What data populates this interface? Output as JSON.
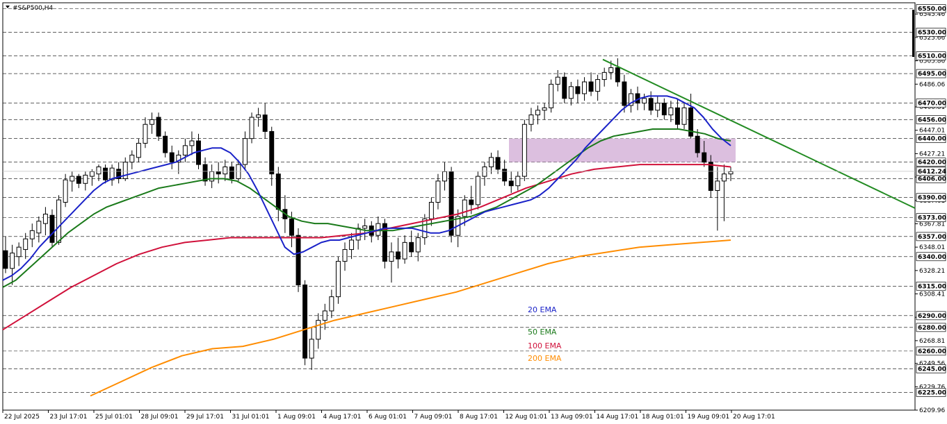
{
  "chart_title": "#S&P500,H4",
  "colors": {
    "background": "#ffffff",
    "candle_up_fill": "#ffffff",
    "candle_down_fill": "#000000",
    "ema20": "#1a22c8",
    "ema50": "#1a7a1a",
    "ema100": "#d0103a",
    "ema200": "#ff8c00",
    "trendline": "#228b22",
    "zone": "#d8b8dc",
    "level_line": "#000000"
  },
  "chart_data": {
    "type": "candlestick",
    "title": "#S&P500,H4",
    "ylim": [
      6209.96,
      6555
    ],
    "price_axis_ticks": [
      "6545.46",
      "6525.66",
      "6505.86",
      "6486.06",
      "6466.81",
      "6447.01",
      "6427.21",
      "6407.41",
      "6387.61",
      "6367.81",
      "6348.01",
      "6328.21",
      "6308.41",
      "6288.61",
      "6268.81",
      "6249.56",
      "6229.76",
      "6209.96"
    ],
    "level_labels": [
      "6550.00",
      "6530.00",
      "6510.00",
      "6495.00",
      "6470.00",
      "6456.00",
      "6440.00",
      "6420.00",
      "6406.00",
      "6390.00",
      "6373.00",
      "6357.00",
      "6340.00",
      "6315.00",
      "6290.00",
      "6280.00",
      "6260.00",
      "6245.00",
      "6225.00"
    ],
    "current_price": "6412.24",
    "time_labels": [
      "22 Jul 2025",
      "23 Jul 17:01",
      "25 Jul 01:01",
      "28 Jul 09:01",
      "29 Jul 17:01",
      "31 Jul 01:01",
      "1 Aug 09:01",
      "4 Aug 17:01",
      "6 Aug 01:01",
      "7 Aug 09:01",
      "8 Aug 17:01",
      "12 Aug 01:01",
      "13 Aug 09:01",
      "14 Aug 17:01",
      "18 Aug 01:01",
      "19 Aug 09:01",
      "20 Aug 17:01"
    ],
    "legend": [
      {
        "label": "20 EMA",
        "color": "#1a22c8"
      },
      {
        "label": "50 EMA",
        "color": "#1a7a1a"
      },
      {
        "label": "100 EMA",
        "color": "#d0103a"
      },
      {
        "label": "200 EMA",
        "color": "#ff8c00"
      }
    ],
    "resistance_zone": {
      "low": 6420,
      "high": 6440
    },
    "trendline": {
      "from": {
        "x": "14 Aug 17:01",
        "y": 6507
      },
      "to": {
        "x": "21 Aug",
        "y": 6381
      }
    },
    "candles": [
      [
        6345,
        6357,
        6326,
        6330
      ],
      [
        6330,
        6350,
        6316,
        6343
      ],
      [
        6340,
        6352,
        6332,
        6348
      ],
      [
        6346,
        6360,
        6338,
        6355
      ],
      [
        6355,
        6368,
        6348,
        6362
      ],
      [
        6360,
        6374,
        6352,
        6370
      ],
      [
        6368,
        6382,
        6358,
        6376
      ],
      [
        6375,
        6380,
        6348,
        6352
      ],
      [
        6352,
        6392,
        6350,
        6388
      ],
      [
        6386,
        6410,
        6382,
        6405
      ],
      [
        6404,
        6412,
        6395,
        6408
      ],
      [
        6408,
        6410,
        6398,
        6402
      ],
      [
        6402,
        6412,
        6396,
        6409
      ],
      [
        6408,
        6414,
        6400,
        6412
      ],
      [
        6410,
        6418,
        6404,
        6416
      ],
      [
        6415,
        6418,
        6402,
        6405
      ],
      [
        6405,
        6418,
        6400,
        6415
      ],
      [
        6414,
        6420,
        6402,
        6406
      ],
      [
        6406,
        6424,
        6404,
        6420
      ],
      [
        6420,
        6430,
        6414,
        6426
      ],
      [
        6424,
        6440,
        6420,
        6436
      ],
      [
        6436,
        6458,
        6432,
        6452
      ],
      [
        6452,
        6462,
        6444,
        6456
      ],
      [
        6458,
        6462,
        6438,
        6442
      ],
      [
        6442,
        6446,
        6424,
        6428
      ],
      [
        6428,
        6434,
        6414,
        6420
      ],
      [
        6420,
        6430,
        6410,
        6426
      ],
      [
        6426,
        6440,
        6420,
        6434
      ],
      [
        6434,
        6446,
        6426,
        6438
      ],
      [
        6438,
        6444,
        6414,
        6418
      ],
      [
        6418,
        6424,
        6400,
        6404
      ],
      [
        6404,
        6418,
        6398,
        6412
      ],
      [
        6412,
        6420,
        6402,
        6410
      ],
      [
        6410,
        6422,
        6404,
        6416
      ],
      [
        6416,
        6420,
        6402,
        6406
      ],
      [
        6406,
        6422,
        6404,
        6418
      ],
      [
        6418,
        6446,
        6414,
        6440
      ],
      [
        6440,
        6462,
        6436,
        6458
      ],
      [
        6458,
        6466,
        6450,
        6460
      ],
      [
        6460,
        6470,
        6440,
        6446
      ],
      [
        6446,
        6450,
        6400,
        6410
      ],
      [
        6410,
        6416,
        6370,
        6380
      ],
      [
        6380,
        6392,
        6360,
        6372
      ],
      [
        6372,
        6378,
        6348,
        6358
      ],
      [
        6358,
        6364,
        6310,
        6316
      ],
      [
        6316,
        6320,
        6248,
        6254
      ],
      [
        6254,
        6280,
        6244,
        6270
      ],
      [
        6270,
        6292,
        6262,
        6286
      ],
      [
        6286,
        6300,
        6278,
        6294
      ],
      [
        6294,
        6312,
        6288,
        6306
      ],
      [
        6306,
        6340,
        6300,
        6336
      ],
      [
        6336,
        6352,
        6328,
        6346
      ],
      [
        6346,
        6360,
        6338,
        6354
      ],
      [
        6354,
        6368,
        6346,
        6364
      ],
      [
        6364,
        6372,
        6354,
        6366
      ],
      [
        6366,
        6370,
        6352,
        6358
      ],
      [
        6358,
        6374,
        6354,
        6368
      ],
      [
        6368,
        6372,
        6330,
        6336
      ],
      [
        6336,
        6352,
        6318,
        6344
      ],
      [
        6344,
        6356,
        6330,
        6338
      ],
      [
        6338,
        6358,
        6334,
        6352
      ],
      [
        6352,
        6362,
        6340,
        6344
      ],
      [
        6344,
        6360,
        6336,
        6356
      ],
      [
        6356,
        6376,
        6350,
        6372
      ],
      [
        6372,
        6390,
        6366,
        6386
      ],
      [
        6386,
        6410,
        6380,
        6404
      ],
      [
        6404,
        6420,
        6396,
        6412
      ],
      [
        6412,
        6416,
        6352,
        6358
      ],
      [
        6358,
        6380,
        6348,
        6374
      ],
      [
        6374,
        6392,
        6366,
        6388
      ],
      [
        6388,
        6400,
        6376,
        6384
      ],
      [
        6384,
        6412,
        6380,
        6408
      ],
      [
        6408,
        6420,
        6400,
        6416
      ],
      [
        6416,
        6428,
        6410,
        6424
      ],
      [
        6424,
        6430,
        6410,
        6414
      ],
      [
        6414,
        6422,
        6400,
        6404
      ],
      [
        6404,
        6412,
        6394,
        6400
      ],
      [
        6400,
        6412,
        6396,
        6408
      ],
      [
        6408,
        6456,
        6404,
        6452
      ],
      [
        6452,
        6466,
        6446,
        6460
      ],
      [
        6460,
        6468,
        6452,
        6464
      ],
      [
        6464,
        6470,
        6456,
        6466
      ],
      [
        6466,
        6490,
        6462,
        6486
      ],
      [
        6486,
        6498,
        6480,
        6492
      ],
      [
        6492,
        6496,
        6470,
        6474
      ],
      [
        6474,
        6488,
        6468,
        6484
      ],
      [
        6484,
        6490,
        6470,
        6478
      ],
      [
        6478,
        6492,
        6472,
        6488
      ],
      [
        6488,
        6496,
        6476,
        6480
      ],
      [
        6480,
        6494,
        6472,
        6490
      ],
      [
        6490,
        6500,
        6484,
        6496
      ],
      [
        6496,
        6506,
        6490,
        6500
      ],
      [
        6500,
        6508,
        6484,
        6488
      ],
      [
        6488,
        6494,
        6462,
        6468
      ],
      [
        6468,
        6482,
        6462,
        6478
      ],
      [
        6478,
        6484,
        6464,
        6470
      ],
      [
        6470,
        6478,
        6464,
        6474
      ],
      [
        6474,
        6480,
        6460,
        6464
      ],
      [
        6464,
        6476,
        6458,
        6470
      ],
      [
        6470,
        6474,
        6456,
        6460
      ],
      [
        6460,
        6472,
        6454,
        6466
      ],
      [
        6466,
        6474,
        6448,
        6452
      ],
      [
        6452,
        6470,
        6448,
        6466
      ],
      [
        6466,
        6478,
        6440,
        6442
      ],
      [
        6442,
        6448,
        6424,
        6428
      ],
      [
        6428,
        6438,
        6416,
        6420
      ],
      [
        6420,
        6426,
        6390,
        6396
      ],
      [
        6396,
        6416,
        6362,
        6404
      ],
      [
        6404,
        6418,
        6370,
        6410
      ],
      [
        6410,
        6416,
        6404,
        6412
      ]
    ],
    "ema20": [
      6320,
      6324,
      6330,
      6338,
      6348,
      6356,
      6364,
      6372,
      6380,
      6388,
      6396,
      6402,
      6406,
      6408,
      6410,
      6412,
      6414,
      6416,
      6418,
      6420,
      6424,
      6428,
      6430,
      6432,
      6432,
      6428,
      6420,
      6410,
      6396,
      6380,
      6364,
      6348,
      6342,
      6344,
      6348,
      6352,
      6354,
      6354,
      6356,
      6358,
      6360,
      6362,
      6364,
      6364,
      6364,
      6364,
      6362,
      6360,
      6360,
      6362,
      6366,
      6370,
      6374,
      6378,
      6380,
      6382,
      6384,
      6386,
      6388,
      6392,
      6398,
      6406,
      6414,
      6422,
      6432,
      6440,
      6448,
      6456,
      6464,
      6470,
      6474,
      6476,
      6476,
      6476,
      6474,
      6470,
      6466,
      6458,
      6448,
      6440,
      6434
    ],
    "ema50": [
      6314,
      6320,
      6330,
      6340,
      6350,
      6360,
      6368,
      6376,
      6382,
      6386,
      6390,
      6394,
      6398,
      6400,
      6402,
      6404,
      6406,
      6406,
      6404,
      6398,
      6390,
      6382,
      6374,
      6370,
      6368,
      6368,
      6366,
      6364,
      6362,
      6362,
      6362,
      6364,
      6366,
      6368,
      6370,
      6372,
      6374,
      6378,
      6382,
      6388,
      6394,
      6400,
      6408,
      6416,
      6424,
      6432,
      6438,
      6442,
      6444,
      6446,
      6448,
      6448,
      6448,
      6446,
      6444,
      6440,
      6438
    ],
    "ema100": [
      6278,
      6290,
      6302,
      6314,
      6324,
      6334,
      6342,
      6348,
      6352,
      6354,
      6356,
      6356,
      6356,
      6356,
      6356,
      6358,
      6360,
      6364,
      6368,
      6372,
      6376,
      6382,
      6390,
      6398,
      6404,
      6410,
      6414,
      6416,
      6418,
      6418,
      6418,
      6418,
      6416
    ],
    "ema200": [
      6222,
      6234,
      6246,
      6256,
      6262,
      6264,
      6270,
      6278,
      6286,
      6292,
      6298,
      6304,
      6310,
      6318,
      6326,
      6334,
      6340,
      6344,
      6348,
      6350,
      6352,
      6354
    ]
  }
}
